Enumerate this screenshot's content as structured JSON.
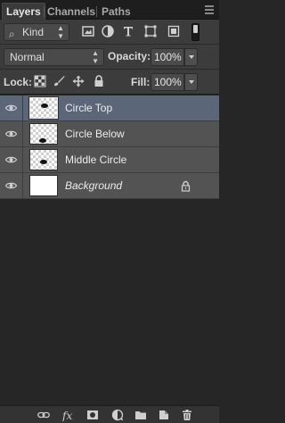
{
  "tabs": [
    {
      "label": "Layers",
      "active": true
    },
    {
      "label": "Channels",
      "active": false
    },
    {
      "label": "Paths",
      "active": false
    }
  ],
  "filter": {
    "kind_label": "Kind",
    "icons": [
      "pixel-filter-icon",
      "adjustment-filter-icon",
      "type-filter-icon",
      "shape-filter-icon",
      "smart-object-filter-icon"
    ]
  },
  "blend": {
    "mode": "Normal",
    "opacity_label": "Opacity:",
    "opacity_value": "100%"
  },
  "lock": {
    "label": "Lock:",
    "fill_label": "Fill:",
    "fill_value": "100%"
  },
  "layers": [
    {
      "name": "Circle Top",
      "selected": true,
      "italic": false,
      "locked": false,
      "thumb": "transparent"
    },
    {
      "name": "Circle Below",
      "selected": false,
      "italic": false,
      "locked": false,
      "thumb": "transparent"
    },
    {
      "name": "Middle Circle",
      "selected": false,
      "italic": false,
      "locked": false,
      "thumb": "transparent"
    },
    {
      "name": "Background",
      "selected": false,
      "italic": true,
      "locked": true,
      "thumb": "white"
    }
  ],
  "bottom_icons": [
    "link-layers-icon",
    "fx-icon",
    "add-mask-icon",
    "adjustment-layer-icon",
    "new-group-icon",
    "new-layer-icon",
    "delete-layer-icon"
  ],
  "colors": {
    "panel_bg": "#262626",
    "row_bg": "#535353",
    "selected_bg": "#5b6779",
    "toolbar_bg": "#3c3c3c"
  }
}
